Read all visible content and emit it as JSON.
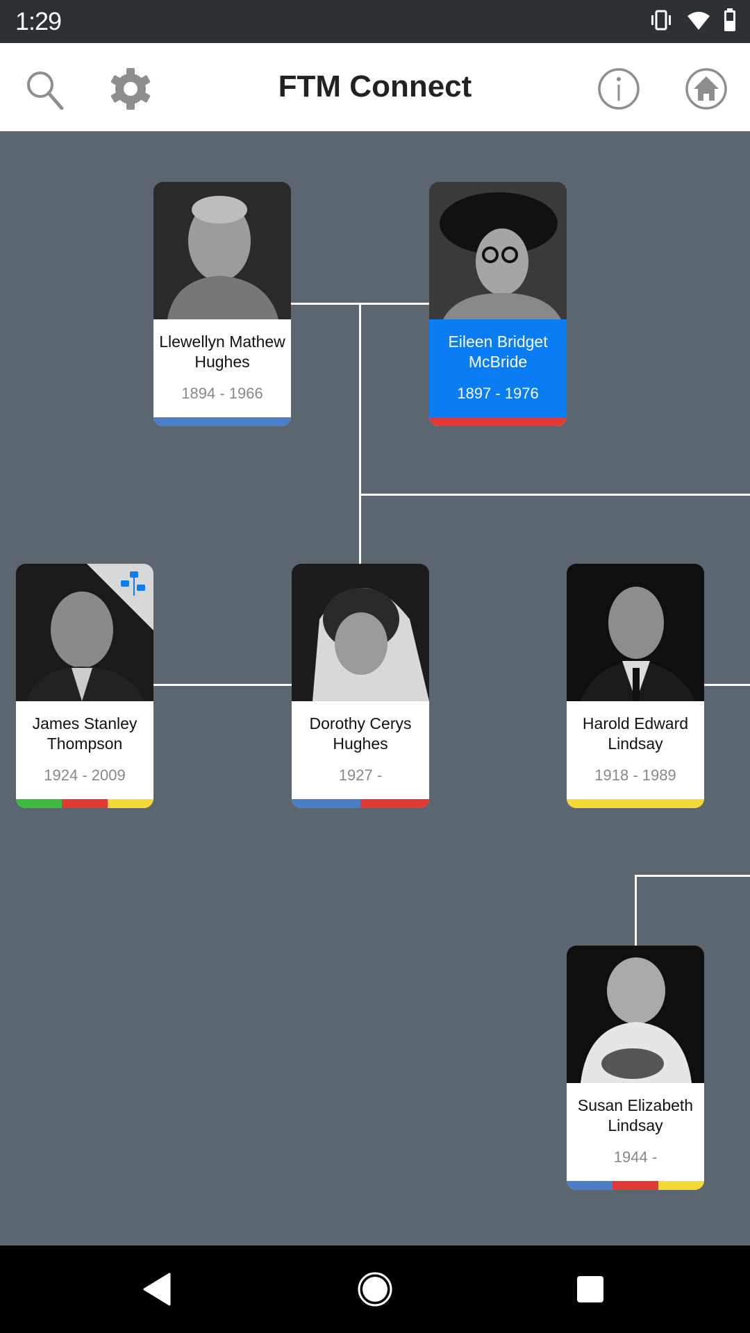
{
  "status_bar": {
    "time": "1:29",
    "icons": [
      "vibrate-icon",
      "wifi-icon",
      "battery-icon"
    ]
  },
  "app_bar": {
    "title": "FTM Connect",
    "left_icons": [
      "search-icon",
      "gear-icon"
    ],
    "right_icons": [
      "info-icon",
      "home-icon"
    ]
  },
  "colors": {
    "background": "#5b6670",
    "selected": "#0a7df5",
    "bar_blue": "#4a7fc8",
    "bar_red": "#e23a36",
    "bar_yellow": "#f6d935",
    "bar_green": "#3fba41"
  },
  "people": [
    {
      "id": "llewellyn",
      "name": "Llewellyn Mathew Hughes",
      "dates": "1894 - 1966",
      "selected": false,
      "bar": [
        "#4a7fc8"
      ]
    },
    {
      "id": "eileen",
      "name": "Eileen Bridget McBride",
      "dates": "1897 - 1976",
      "selected": true,
      "bar": [
        "#e23a36"
      ]
    },
    {
      "id": "james",
      "name": "James Stanley Thompson",
      "dates": "1924 - 2009",
      "selected": false,
      "has_tree_badge": true,
      "bar": [
        "#3fba41",
        "#e23a36",
        "#f6d935"
      ]
    },
    {
      "id": "dorothy",
      "name": "Dorothy Cerys Hughes",
      "dates": "1927 -",
      "selected": false,
      "bar": [
        "#4a7fc8",
        "#e23a36"
      ]
    },
    {
      "id": "harold",
      "name": "Harold Edward Lindsay",
      "dates": "1918 - 1989",
      "selected": false,
      "bar": [
        "#f6d935"
      ]
    },
    {
      "id": "susan",
      "name": "Susan Elizabeth Lindsay",
      "dates": "1944 -",
      "selected": false,
      "bar": [
        "#4a7fc8",
        "#e23a36",
        "#f6d935"
      ]
    }
  ],
  "nav_bar": {
    "buttons": [
      "back-icon",
      "home-circle-icon",
      "recents-icon"
    ]
  }
}
